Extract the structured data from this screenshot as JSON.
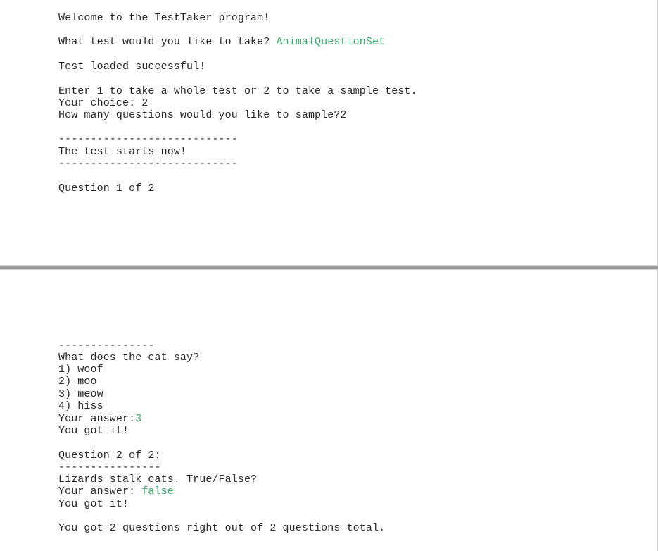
{
  "colors": {
    "text": "#2a2a2a",
    "user_input": "#3aa96a",
    "divider": "#9e9e9e"
  },
  "top": {
    "welcome": "Welcome to the TestTaker program!",
    "test_prompt": "What test would you like to take? ",
    "test_input": "AnimalQuestionSet",
    "loaded": "Test loaded successful!",
    "mode_prompt": "Enter 1 to take a whole test or 2 to take a sample test.",
    "choice_prompt": "Your choice: ",
    "choice_value": "2",
    "sample_prompt": "How many questions would you like to sample?",
    "sample_value": "2",
    "separator_long": "----------------------------",
    "starts": "The test starts now!",
    "question_header_1": "Question 1 of 2"
  },
  "bottom": {
    "separator_q1": "---------------",
    "q1_text": "What does the cat say?",
    "q1_options": [
      "1) woof",
      "2) moo",
      "3) meow",
      "4) hiss"
    ],
    "q1_answer_prompt": "Your answer:",
    "q1_answer_value": "3",
    "q1_result": "You got it!",
    "question_header_2": "Question 2 of 2:",
    "separator_q2": "----------------",
    "q2_text": "Lizards stalk cats. True/False?",
    "q2_answer_prompt": "Your answer: ",
    "q2_answer_value": "false",
    "q2_result": "You got it!",
    "summary": "You got 2 questions right out of 2 questions total."
  }
}
